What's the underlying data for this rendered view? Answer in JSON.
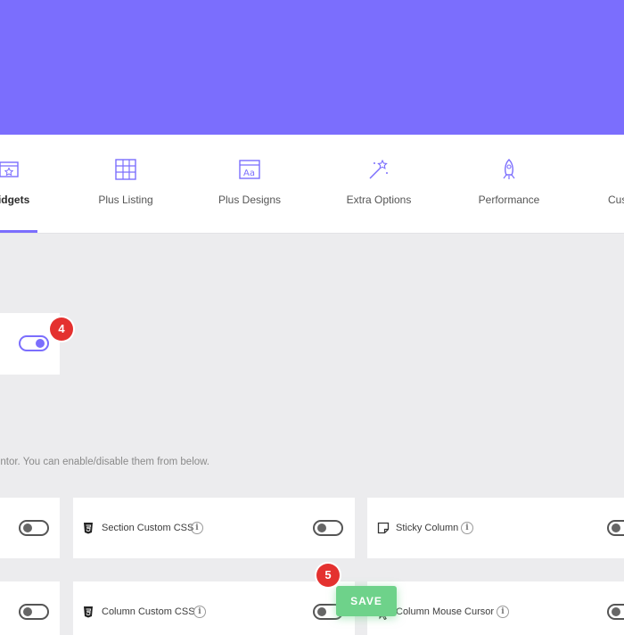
{
  "colors": {
    "accent": "#7b6efd",
    "banner": "#7b6efd",
    "save": "#6ed28a",
    "badge": "#e4312f"
  },
  "tabs": [
    {
      "label": "Widgets",
      "icon": "widgets-star-icon",
      "active": true
    },
    {
      "label": "Plus Listing",
      "icon": "grid-listing-icon",
      "active": false
    },
    {
      "label": "Plus Designs",
      "icon": "typography-designs-icon",
      "active": false
    },
    {
      "label": "Extra Options",
      "icon": "magic-wand-icon",
      "active": false
    },
    {
      "label": "Performance",
      "icon": "rocket-icon",
      "active": false
    },
    {
      "label": "Cus",
      "icon": "custom-icon",
      "active": false
    }
  ],
  "master_toggle": {
    "enabled": true
  },
  "description": "ementor. You can enable/disable them from below.",
  "badges": {
    "step4": "4",
    "step5": "5"
  },
  "extensions": [
    {
      "label": "",
      "enabled": false
    },
    {
      "label": "Section Custom CSS",
      "icon": "css3-icon",
      "enabled": false
    },
    {
      "label": "Sticky Column",
      "icon": "sticky-note-icon",
      "enabled": false
    },
    {
      "label": "",
      "enabled": false
    },
    {
      "label": "Column Custom CSS",
      "icon": "css3-icon",
      "enabled": false
    },
    {
      "label": "Column Mouse Cursor",
      "icon": "mouse-cursor-icon",
      "enabled": false
    }
  ],
  "info_glyph": "i",
  "save_label": "SAVE"
}
